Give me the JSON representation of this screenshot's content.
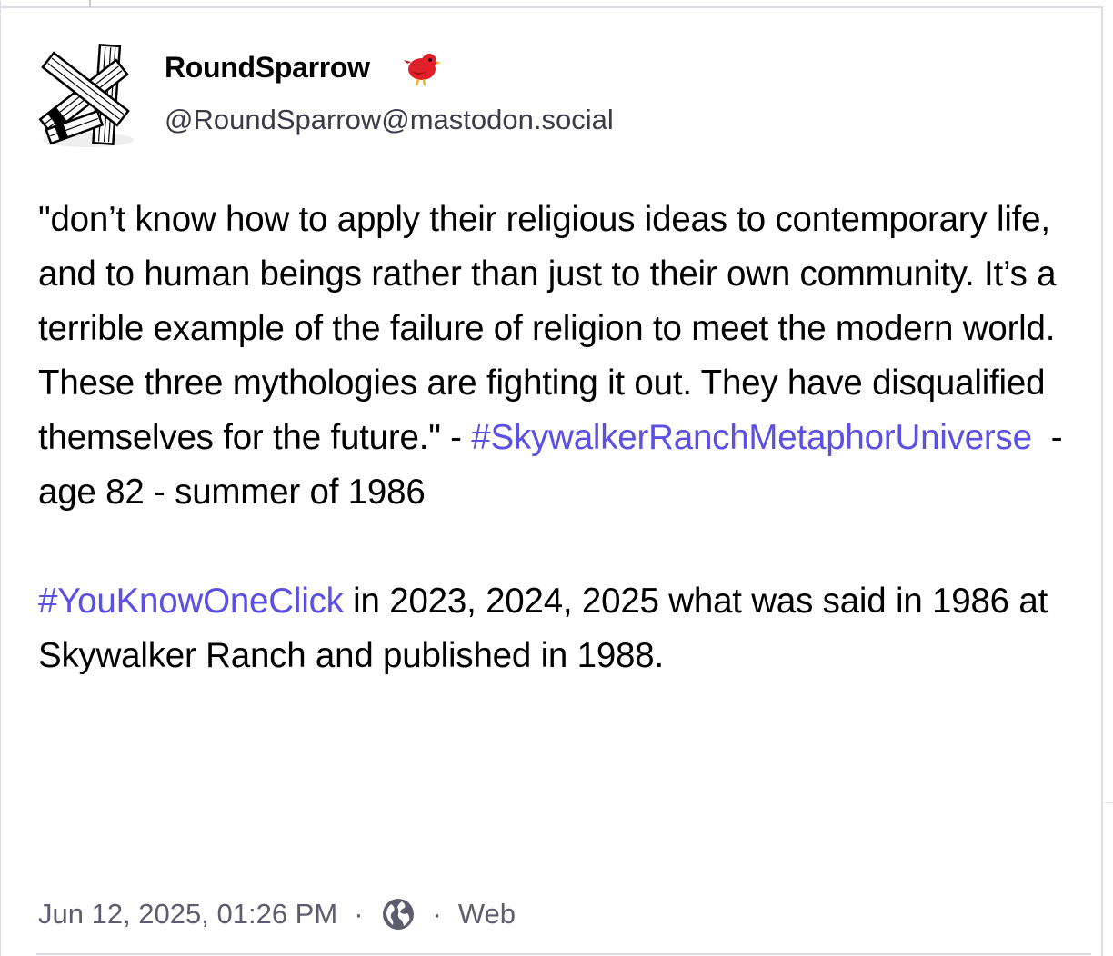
{
  "author": {
    "display_name": "RoundSparrow",
    "handle": "@RoundSparrow@mastodon.social",
    "avatar_icon": "crossed-sticks-avatar-icon",
    "badge_icon": "red-bird-emoji-icon"
  },
  "post": {
    "paragraph1": {
      "quote": "\"don’t know how to apply their religious ideas to contemporary life, and to human beings rather than just to their own community. It’s a terrible example of the failure of religion to meet the modern world. These three mythologies are fighting it out. They have disqualified themselves for the future.\" - ",
      "hashtag": "#SkywalkerRanchMetaphorUniverse",
      "tail": "  - age 82 - summer of 1986"
    },
    "paragraph2": {
      "hashtag": "#YouKnowOneClick",
      "tail": " in 2023, 2024, 2025 what was said in 1986 at Skywalker Ranch and published in 1988."
    }
  },
  "meta": {
    "timestamp": "Jun 12, 2025, 01:26 PM",
    "separator": "·",
    "visibility_icon": "globe-icon",
    "application": "Web"
  },
  "colors": {
    "hashtag": "#5c4fe6",
    "secondary_text": "#5e5d6f",
    "border": "#dcdbe6"
  }
}
